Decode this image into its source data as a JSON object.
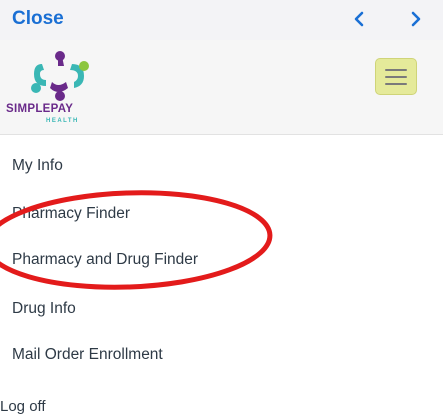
{
  "topbar": {
    "close_label": "Close",
    "prev_icon": "chevron-left-icon",
    "next_icon": "chevron-right-icon",
    "accent_color": "#1a6fd4"
  },
  "header": {
    "logo": {
      "brand": "SIMPLEPAY",
      "brand_sub": "HEALTH",
      "colors": {
        "purple": "#6a2a8a",
        "teal": "#3ab7b5",
        "green": "#8cc63f"
      }
    },
    "menu_button_icon": "hamburger-menu-icon",
    "menu_button_color": "#e5ea9a"
  },
  "menu": {
    "items": [
      {
        "label": "My Info"
      },
      {
        "label": "Pharmacy Finder"
      },
      {
        "label": "Pharmacy and Drug Finder"
      },
      {
        "label": "Drug Info"
      },
      {
        "label": "Mail Order Enrollment"
      }
    ],
    "logoff_label": "Log off"
  },
  "annotation": {
    "shape": "ellipse",
    "color": "#e31b1b"
  }
}
